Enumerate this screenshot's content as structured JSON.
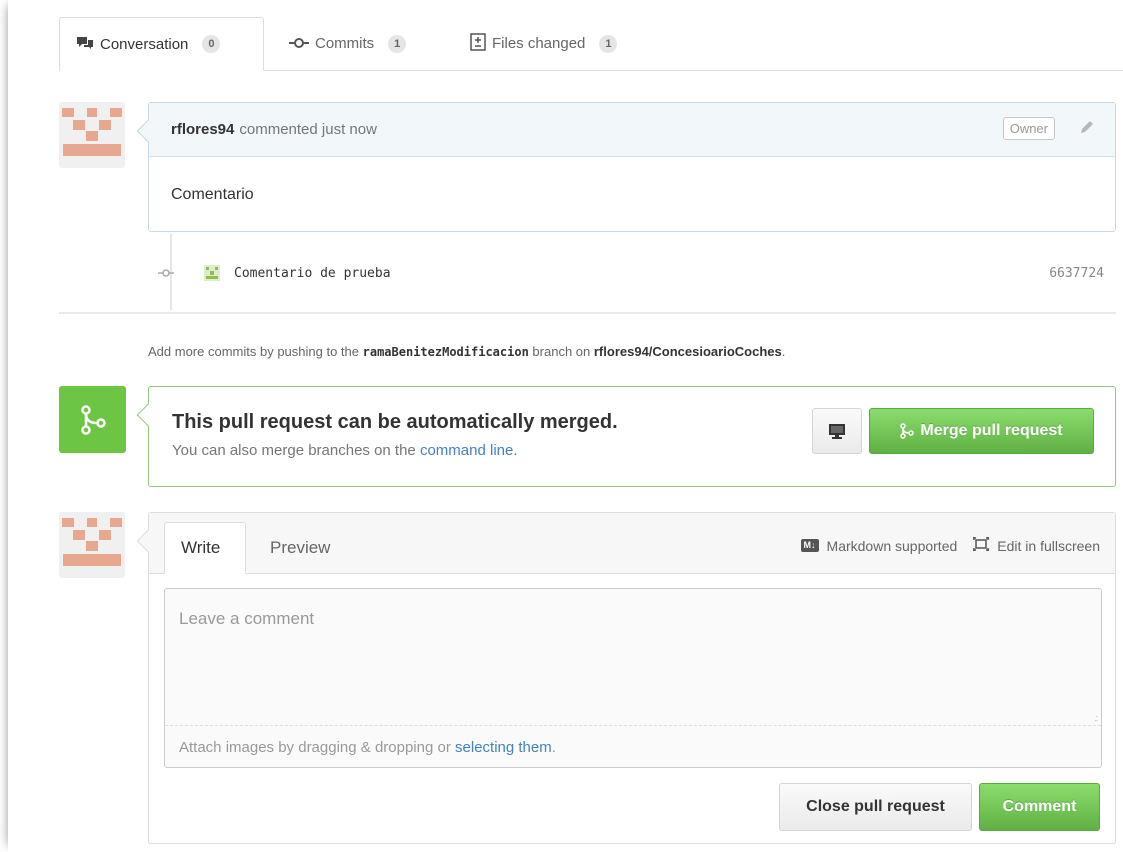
{
  "tabs": [
    {
      "label": "Conversation",
      "count": "0",
      "icon": "comment-discussion-icon"
    },
    {
      "label": "Commits",
      "count": "1",
      "icon": "git-commit-icon"
    },
    {
      "label": "Files changed",
      "count": "1",
      "icon": "diff-icon"
    }
  ],
  "comment": {
    "author": "rflores94",
    "action": "commented just now",
    "badge": "Owner",
    "body": "Comentario"
  },
  "commit": {
    "message": "Comentario de prueba",
    "sha": "6637724"
  },
  "info": {
    "prefix": "Add more commits by pushing to the",
    "branch": "ramaBenitezModificacion",
    "middle": "branch on",
    "repo": "rflores94/ConcesioarioCoches",
    "suffix": "."
  },
  "merge": {
    "title": "This pull request can be automatically merged.",
    "sub_prefix": "You can also merge branches on the",
    "sub_link": "command line",
    "sub_suffix": ".",
    "button": "Merge pull request"
  },
  "composer": {
    "tab_write": "Write",
    "tab_preview": "Preview",
    "markdown_badge": "M↓",
    "markdown_label": "Markdown supported",
    "fullscreen_label": "Edit in fullscreen",
    "placeholder": "Leave a comment",
    "attach_prefix": "Attach images by dragging & dropping or",
    "attach_link": "selecting them",
    "attach_suffix": ".",
    "close_button": "Close pull request",
    "comment_button": "Comment"
  },
  "colors": {
    "green": "#6cc644",
    "link": "#4183c4",
    "avatar": "#e8a88f"
  }
}
